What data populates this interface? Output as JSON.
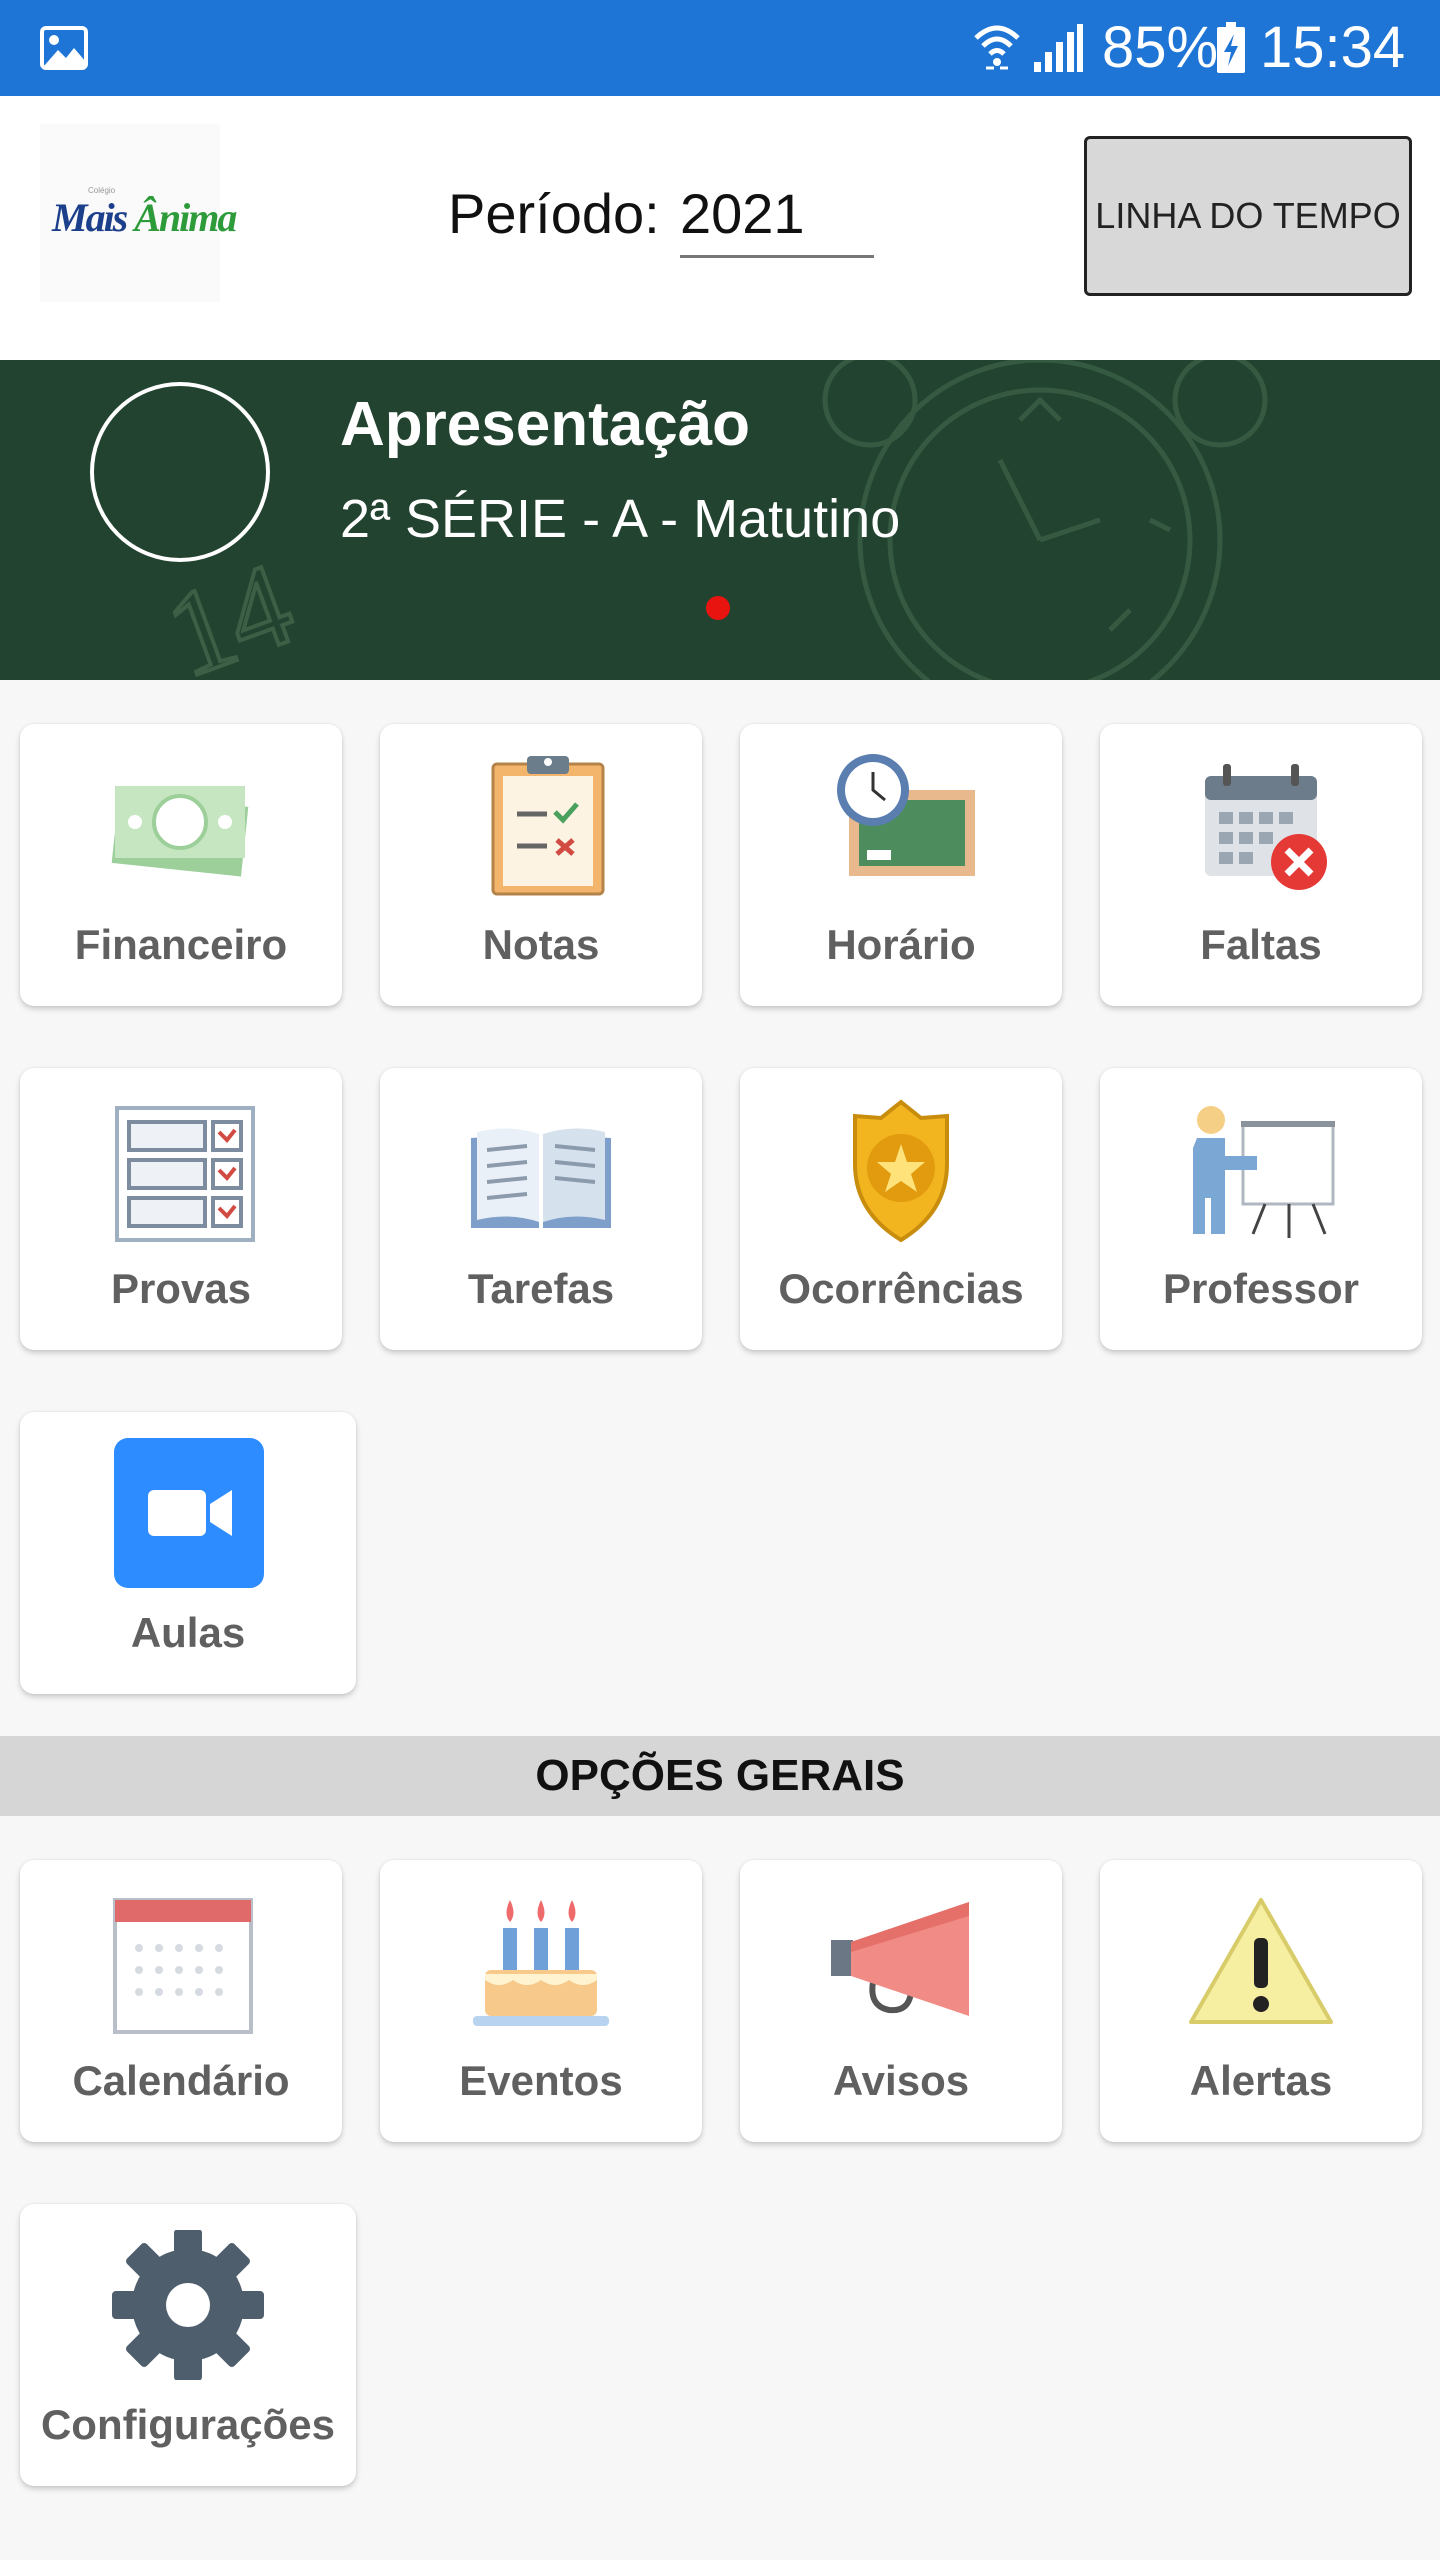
{
  "status_bar": {
    "battery_percent": "85%",
    "time": "15:34",
    "icons": [
      "image-icon",
      "wifi-icon",
      "signal-icon",
      "battery-charging-icon"
    ]
  },
  "header": {
    "logo_text_small": "Colégio",
    "logo_text_main": "Mais Ânima",
    "periodo_label": "Período:",
    "periodo_value": "2021",
    "timeline_button": "LINHA DO TEMPO"
  },
  "banner": {
    "title": "Apresentação",
    "subtitle": "2ª SÉRIE - A - Matutino",
    "background_color": "#22432f",
    "page_indicator_color": "#e8140f",
    "background_number": "14"
  },
  "menu": {
    "items": [
      {
        "label": "Financeiro",
        "icon": "money-icon"
      },
      {
        "label": "Notas",
        "icon": "clipboard-icon"
      },
      {
        "label": "Horário",
        "icon": "clock-board-icon"
      },
      {
        "label": "Faltas",
        "icon": "calendar-x-icon"
      },
      {
        "label": "Provas",
        "icon": "checklist-icon"
      },
      {
        "label": "Tarefas",
        "icon": "book-icon"
      },
      {
        "label": "Ocorrências",
        "icon": "badge-icon"
      },
      {
        "label": "Professor",
        "icon": "teacher-icon"
      },
      {
        "label": "Aulas",
        "icon": "video-camera-icon"
      }
    ]
  },
  "general": {
    "section_title": "OPÇÕES GERAIS",
    "items": [
      {
        "label": "Calendário",
        "icon": "calendar-icon"
      },
      {
        "label": "Eventos",
        "icon": "cake-icon"
      },
      {
        "label": "Avisos",
        "icon": "megaphone-icon"
      },
      {
        "label": "Alertas",
        "icon": "warning-icon"
      },
      {
        "label": "Configurações",
        "icon": "gear-icon"
      }
    ]
  },
  "colors": {
    "status_bar": "#1e75d5",
    "tile_label": "#606060",
    "section_bar": "#d6d6d6"
  }
}
